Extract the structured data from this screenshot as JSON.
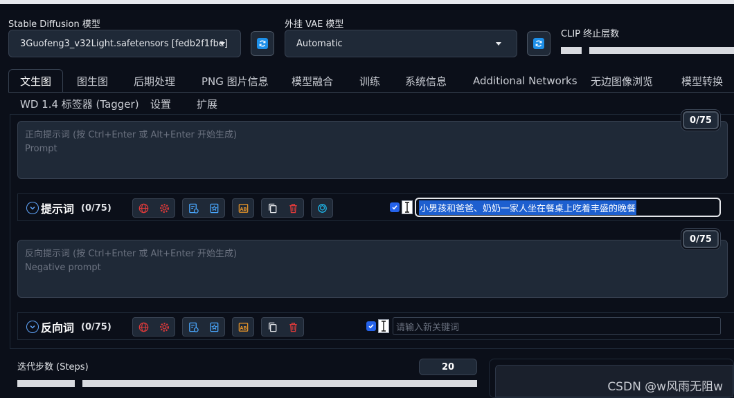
{
  "models": {
    "sd_label": "Stable Diffusion 模型",
    "sd_value": "3Guofeng3_v32Light.safetensors [fedb2f1fbe]",
    "vae_label": "外挂 VAE 模型",
    "vae_value": "Automatic",
    "clip_label": "CLIP 终止层数",
    "clip_value_fraction": 0.04
  },
  "tabs": [
    "文生图",
    "图生图",
    "后期处理",
    "PNG 图片信息",
    "模型融合",
    "训练",
    "系统信息",
    "Additional Networks",
    "无边图像浏览",
    "模型转换"
  ],
  "tabs_row2": [
    "WD 1.4 标签器 (Tagger)",
    "设置",
    "扩展"
  ],
  "prompt": {
    "placeholder_line1": "正向提示词 (按 Ctrl+Enter 或 Alt+Enter 开始生成)",
    "placeholder_line2": "Prompt",
    "counter": "0/75"
  },
  "prompt_tool": {
    "title": "提示词",
    "count": "(0/75)",
    "keyword_value": "小男孩和爸爸、奶奶一家人坐在餐桌上吃着丰盛的晚餐"
  },
  "negative": {
    "placeholder_line1": "反向提示词 (按 Ctrl+Enter 或 Alt+Enter 开始生成)",
    "placeholder_line2": "Negative prompt",
    "counter": "0/75"
  },
  "negative_tool": {
    "title": "反向词",
    "count": "(0/75)",
    "keyword_placeholder": "请输入新关键词"
  },
  "steps": {
    "label": "迭代步数 (Steps)",
    "value": "20"
  },
  "watermark": "CSDN @w风雨无阻w",
  "colors": {
    "background": "#0b0f19",
    "panel": "#1f2937",
    "accent_blue": "#1d8fe8",
    "icon_red": "#e03a3a",
    "icon_blue": "#4aa8ff",
    "icon_orange": "#e0912a",
    "icon_cyan": "#1fb5e8"
  }
}
